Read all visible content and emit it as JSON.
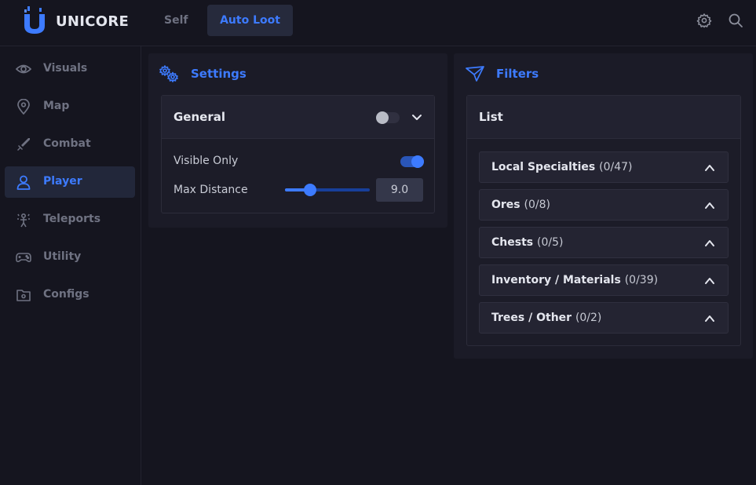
{
  "app": {
    "brand": "UNICORE",
    "accent": "#3d7bff"
  },
  "tabs": [
    {
      "label": "Self",
      "active": false
    },
    {
      "label": "Auto Loot",
      "active": true
    }
  ],
  "top_icons": [
    "gear-icon",
    "search-icon"
  ],
  "sidebar": {
    "items": [
      {
        "label": "Visuals",
        "icon": "eye-icon"
      },
      {
        "label": "Map",
        "icon": "map-pin-icon"
      },
      {
        "label": "Combat",
        "icon": "sword-icon"
      },
      {
        "label": "Player",
        "icon": "user-icon",
        "active": true
      },
      {
        "label": "Teleports",
        "icon": "teleport-icon"
      },
      {
        "label": "Utility",
        "icon": "gamepad-icon"
      },
      {
        "label": "Configs",
        "icon": "folder-icon"
      }
    ]
  },
  "settings": {
    "title": "Settings",
    "general": {
      "label": "General",
      "enabled": false,
      "visible_only": {
        "label": "Visible Only",
        "enabled": true
      },
      "max_distance": {
        "label": "Max Distance",
        "value": "9.0",
        "fraction": 0.3
      }
    }
  },
  "filters": {
    "title": "Filters",
    "list_label": "List",
    "items": [
      {
        "name": "Local Specialties",
        "count": "(0/47)"
      },
      {
        "name": "Ores",
        "count": "(0/8)"
      },
      {
        "name": "Chests",
        "count": "(0/5)"
      },
      {
        "name": "Inventory / Materials",
        "count": "(0/39)"
      },
      {
        "name": "Trees / Other",
        "count": "(0/2)"
      }
    ]
  }
}
